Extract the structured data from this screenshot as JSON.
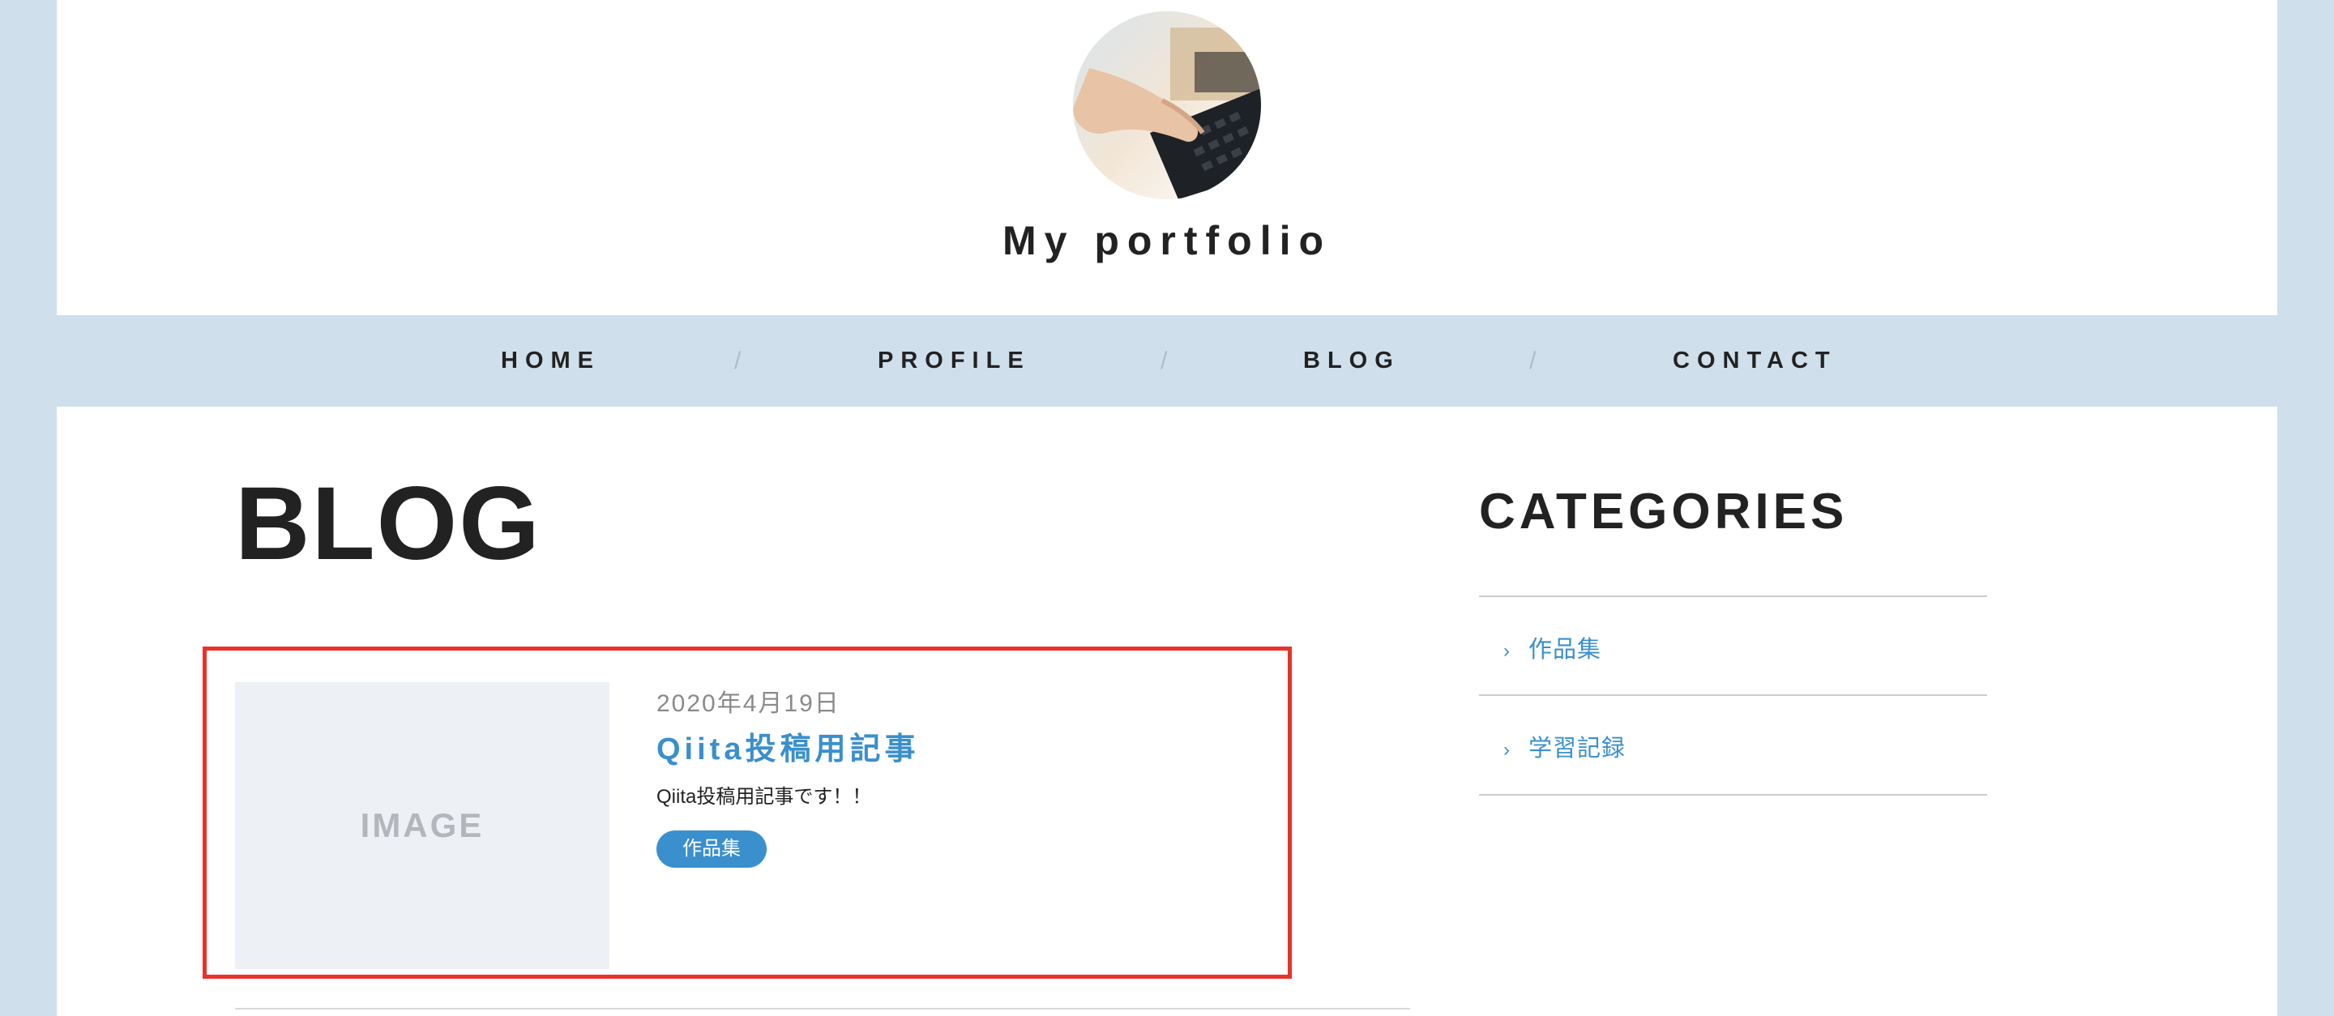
{
  "site": {
    "title": "My portfolio"
  },
  "nav": {
    "items": [
      {
        "label": "HOME"
      },
      {
        "label": "PROFILE"
      },
      {
        "label": "BLOG"
      },
      {
        "label": "CONTACT"
      }
    ],
    "separator": "/"
  },
  "main": {
    "heading": "BLOG",
    "posts": [
      {
        "thumbnail_text": "IMAGE",
        "date": "2020年4月19日",
        "title": "Qiita投稿用記事",
        "excerpt": "Qiita投稿用記事です！！",
        "tag": "作品集"
      }
    ]
  },
  "sidebar": {
    "heading": "CATEGORIES",
    "chevron": "›",
    "items": [
      {
        "label": "作品集"
      },
      {
        "label": "学習記録"
      }
    ]
  },
  "colors": {
    "background": "#cfe0ec",
    "accent": "#3a8fcd",
    "highlight_border": "#e8332a",
    "text": "#222222"
  }
}
